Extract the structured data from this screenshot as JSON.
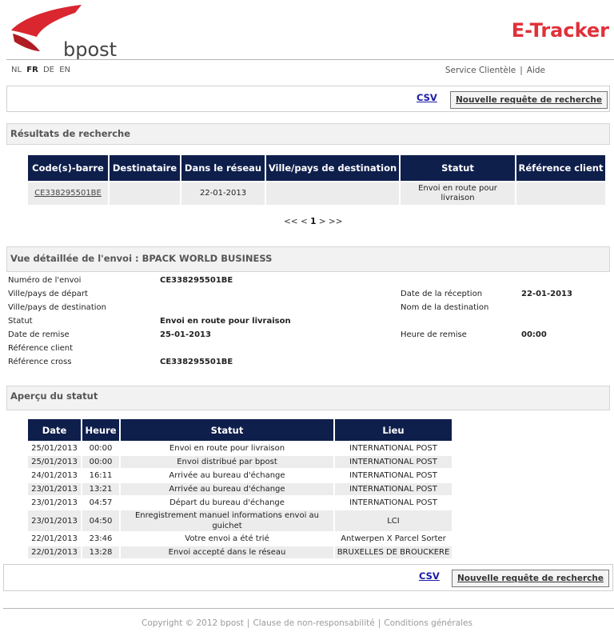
{
  "header": {
    "logo_text": "bpost",
    "title": "E-Tracker"
  },
  "languages": [
    {
      "code": "NL",
      "active": false
    },
    {
      "code": "FR",
      "active": true
    },
    {
      "code": "DE",
      "active": false
    },
    {
      "code": "EN",
      "active": false
    }
  ],
  "toplinks": {
    "service": "Service Clientèle",
    "separator": "|",
    "help": "Aide"
  },
  "actions": {
    "csv_label": "CSV",
    "new_search_label": "Nouvelle requête de recherche"
  },
  "results": {
    "title": "Résultats de recherche",
    "columns": [
      "Code(s)-barre",
      "Destinataire",
      "Dans le réseau",
      "Ville/pays de destination",
      "Statut",
      "Référence client"
    ],
    "rows": [
      {
        "barcode": "CE338295501BE",
        "recipient": "",
        "in_network": "22-01-2013",
        "destination": "",
        "status": "Envoi en route pour livraison",
        "reference": ""
      }
    ],
    "pager": {
      "prev_prev": "<<",
      "prev": "<",
      "page": "1",
      "next": ">",
      "next_next": ">>"
    }
  },
  "detail": {
    "title": "Vue détaillée de l'envoi : BPACK WORLD BUSINESS",
    "left": [
      {
        "label": "Numéro de l'envoi",
        "value": "CE338295501BE"
      },
      {
        "label": "Ville/pays de départ",
        "value": ""
      },
      {
        "label": "Ville/pays de destination",
        "value": ""
      },
      {
        "label": "Statut",
        "value": "Envoi en route pour livraison"
      },
      {
        "label": "Date de remise",
        "value": "25-01-2013"
      },
      {
        "label": "Référence client",
        "value": ""
      },
      {
        "label": "Référence cross",
        "value": "CE338295501BE"
      }
    ],
    "right": [
      {
        "label": "Date de la réception",
        "value": "22-01-2013"
      },
      {
        "label": "Nom de la destination",
        "value": ""
      },
      {
        "label": "Heure de remise",
        "value": "00:00"
      }
    ]
  },
  "status_overview": {
    "title": "Aperçu du statut",
    "columns": [
      "Date",
      "Heure",
      "Statut",
      "Lieu"
    ],
    "rows": [
      {
        "date": "25/01/2013",
        "time": "00:00",
        "status": "Envoi en route pour livraison",
        "place": "INTERNATIONAL POST"
      },
      {
        "date": "25/01/2013",
        "time": "00:00",
        "status": "Envoi distribué par bpost",
        "place": "INTERNATIONAL POST"
      },
      {
        "date": "24/01/2013",
        "time": "16:11",
        "status": "Arrivée au bureau d'échange",
        "place": "INTERNATIONAL POST"
      },
      {
        "date": "23/01/2013",
        "time": "13:21",
        "status": "Arrivée au bureau d'échange",
        "place": "INTERNATIONAL POST"
      },
      {
        "date": "23/01/2013",
        "time": "04:57",
        "status": "Départ du bureau d'échange",
        "place": "INTERNATIONAL POST"
      },
      {
        "date": "23/01/2013",
        "time": "04:50",
        "status": "Enregistrement manuel informations envoi au guichet",
        "place": "LCI"
      },
      {
        "date": "22/01/2013",
        "time": "23:46",
        "status": "Votre envoi a été trié",
        "place": "Antwerpen X Parcel Sorter"
      },
      {
        "date": "22/01/2013",
        "time": "13:28",
        "status": "Envoi accepté dans le réseau",
        "place": "BRUXELLES DE BROUCKERE"
      }
    ]
  },
  "footer": {
    "copyright": "Copyright © 2012 bpost",
    "disclaimer": "Clause de non-responsabilité",
    "terms": "Conditions générales",
    "separator": "|"
  },
  "colors": {
    "brand_red": "#e0313a",
    "header_navy": "#0f1f4c",
    "link_blue": "#1a1aa6"
  }
}
